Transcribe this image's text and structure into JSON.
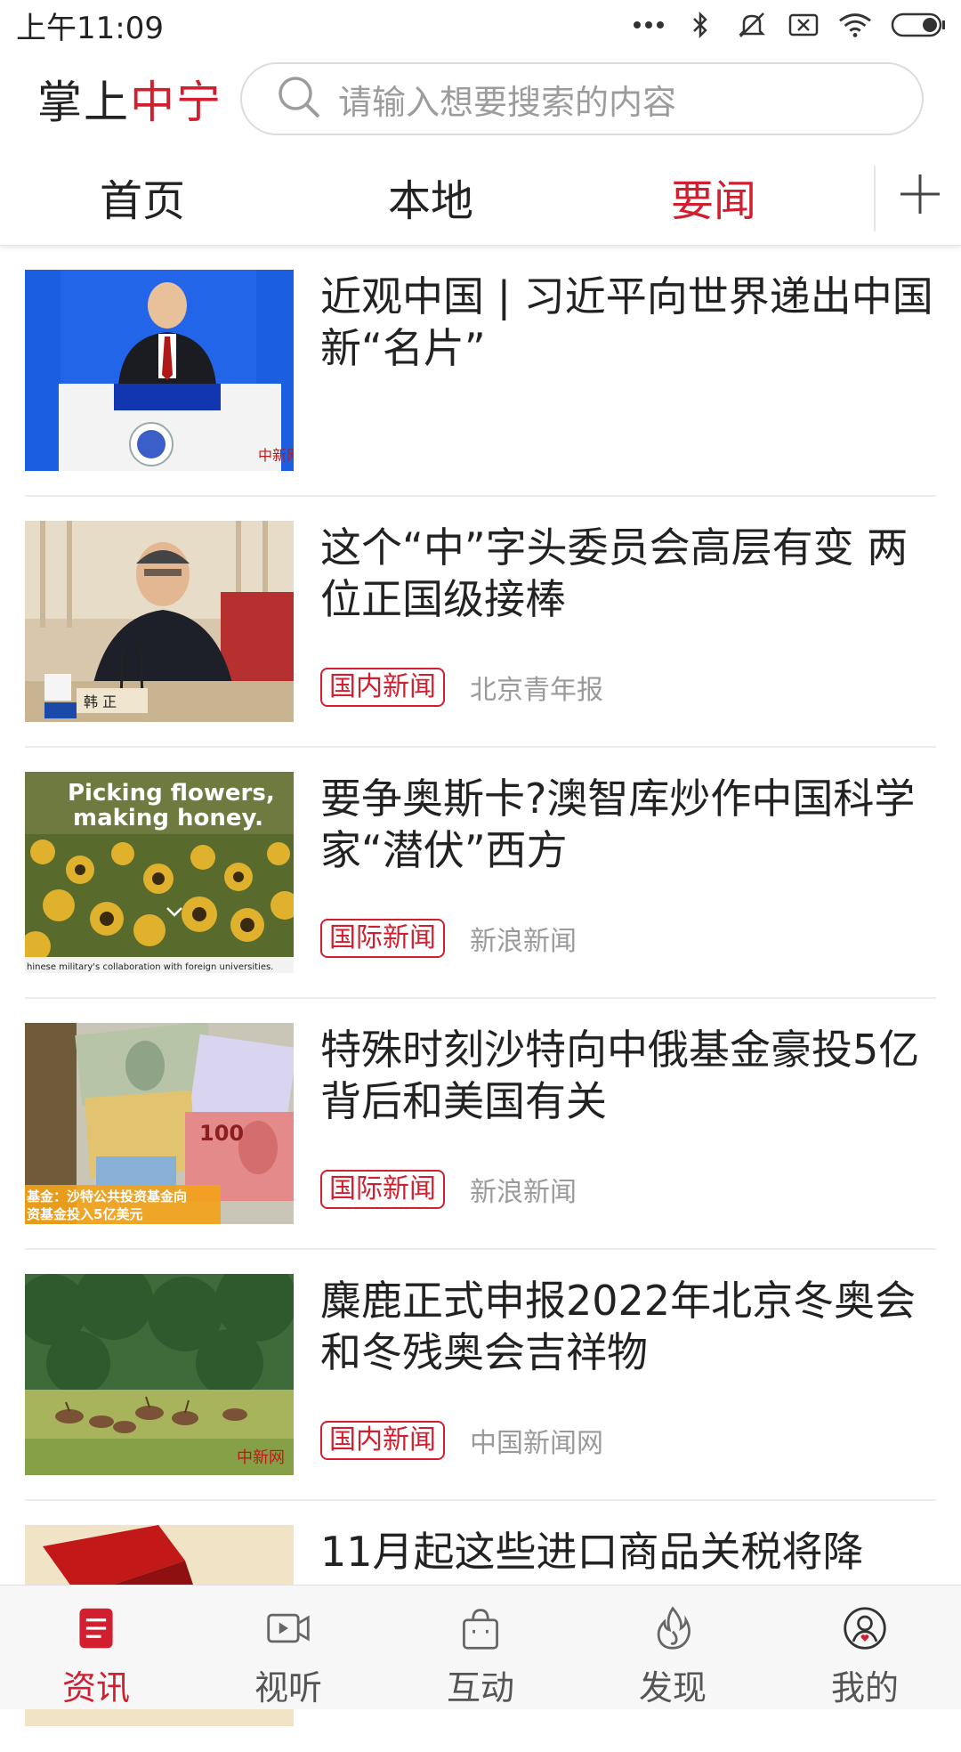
{
  "status_bar": {
    "time": "上午11:09",
    "icons": [
      "more-dots-icon",
      "bluetooth-icon",
      "mute-icon",
      "sim-off-icon",
      "wifi-icon",
      "battery-icon"
    ]
  },
  "header": {
    "logo_prefix": "掌上",
    "logo_accent": "中宁",
    "search_placeholder": "请输入想要搜索的内容"
  },
  "tabs": [
    {
      "label": "首页",
      "active": false
    },
    {
      "label": "本地",
      "active": false
    },
    {
      "label": "要闻",
      "active": true
    }
  ],
  "news": [
    {
      "title": "近观中国 | 习近平向世界递出中国新“名片”",
      "tag": "",
      "source": ""
    },
    {
      "title": "这个“中”字头委员会高层有变 两位正国级接棒",
      "tag": "国内新闻",
      "source": "北京青年报"
    },
    {
      "title": "要争奥斯卡?澳智库炒作中国科学家“潜伏”西方",
      "tag": "国际新闻",
      "source": "新浪新闻"
    },
    {
      "title": "特殊时刻沙特向中俄基金豪投5亿 背后和美国有关",
      "tag": "国际新闻",
      "source": "新浪新闻"
    },
    {
      "title": "麋鹿正式申报2022年北京冬奥会和冬残奥会吉祥物",
      "tag": "国内新闻",
      "source": "中国新闻网"
    },
    {
      "title": "11月起这些进口商品关税将降",
      "tag": "",
      "source": ""
    }
  ],
  "thumbs": {
    "t3_line1": "Picking flowers,",
    "t3_line2": "making honey.",
    "t3_caption": "hinese military's collaboration with foreign universities.",
    "t4_line1": "基金：沙特公共投资基金向",
    "t4_line2": "资基金投入5亿美元"
  },
  "bottom_nav": [
    {
      "label": "资讯",
      "icon": "news-icon",
      "active": true
    },
    {
      "label": "视听",
      "icon": "video-icon",
      "active": false
    },
    {
      "label": "互动",
      "icon": "bag-icon",
      "active": false
    },
    {
      "label": "发现",
      "icon": "flame-icon",
      "active": false
    },
    {
      "label": "我的",
      "icon": "user-icon",
      "active": false
    }
  ],
  "colors": {
    "accent": "#d21f2f",
    "text": "#222222",
    "muted": "#9a9a9a"
  }
}
